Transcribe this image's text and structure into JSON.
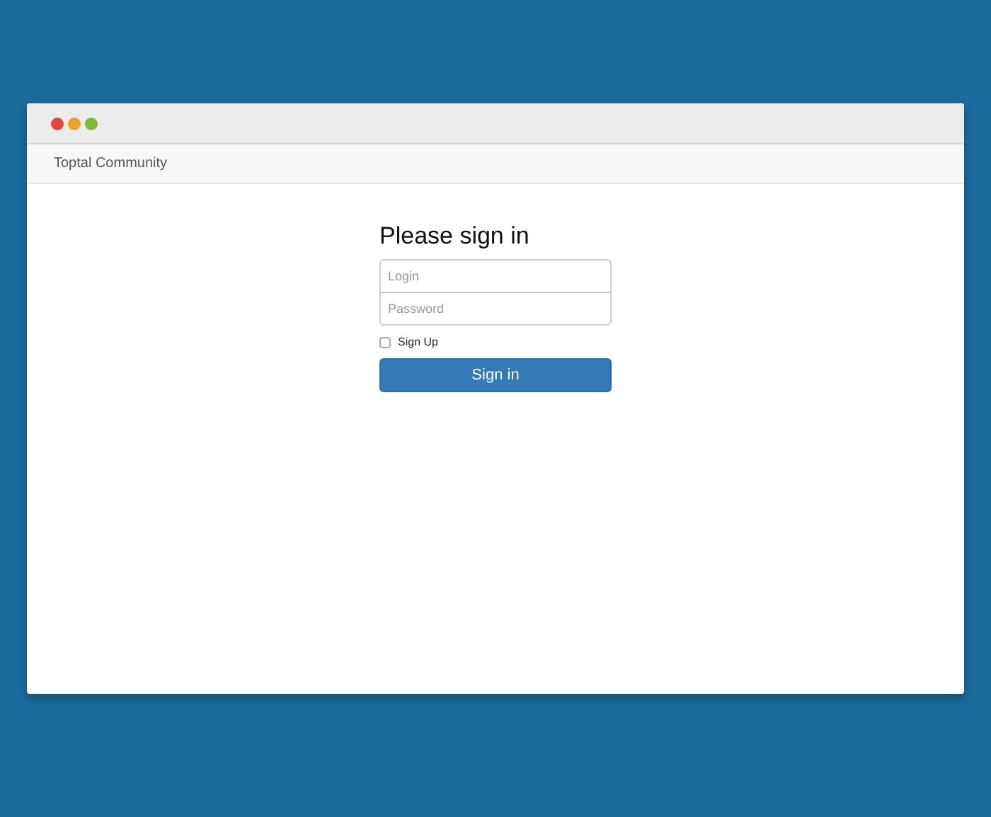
{
  "window": {
    "controls": [
      {
        "color": "#e0483e"
      },
      {
        "color": "#e8a42a"
      },
      {
        "color": "#7bbd2c"
      }
    ]
  },
  "navbar": {
    "brand": "Toptal Community"
  },
  "form": {
    "heading": "Please sign in",
    "fields": [
      {
        "placeholder": "Login"
      },
      {
        "placeholder": "Password"
      }
    ],
    "signup": {
      "label": "Sign Up",
      "checked": false
    },
    "button": "Sign in"
  }
}
